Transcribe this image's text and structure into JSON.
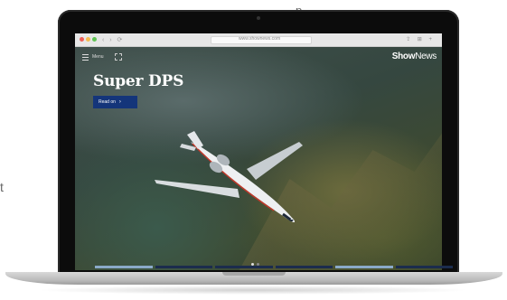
{
  "fragments": {
    "top_text": "p",
    "side_text": "t"
  },
  "browser": {
    "url": "www.shownews.com",
    "nav_glyphs": "‹ › ⟳",
    "toolbar_glyphs": "⇪ ⊞ +"
  },
  "site": {
    "menu_label": "Menu",
    "logo_show": "Show",
    "logo_news": "News"
  },
  "hero": {
    "headline": "Super DPS",
    "button_label": "Read on",
    "button_arrow": "›",
    "carousel": {
      "total": 2,
      "active_index": 0
    }
  },
  "colors": {
    "brand_button": "#14357a",
    "logo": "#ffffff"
  }
}
